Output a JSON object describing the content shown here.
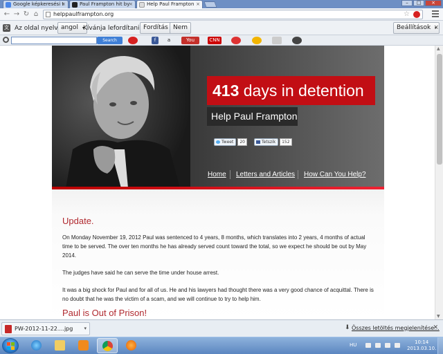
{
  "browser": {
    "tabs": [
      {
        "label": "Google képkeresési t",
        "active": false
      },
      {
        "label": "Paul Frampton hit by",
        "active": false
      },
      {
        "label": "Help Paul Frampton",
        "active": true
      }
    ],
    "url": "helppaulframpton.org"
  },
  "translate_bar": {
    "prefix": "Az oldal nyelve",
    "language": "angol",
    "question": "Kívánja lefordítani?",
    "translate_label": "Fordítás",
    "no_label": "Nem",
    "settings_label": "Beállítások"
  },
  "search_toolbar": {
    "button_label": "Search"
  },
  "site": {
    "days_count": "413",
    "days_text": "days in detention",
    "help_title": "Help Paul Frampton",
    "tweet_label": "Tweet",
    "tweet_count": "20",
    "fb_label": "Tetszik",
    "fb_count": "152",
    "nav": [
      "Home",
      "Letters and Articles",
      "How Can You Help?"
    ],
    "update_heading": "Update.",
    "paragraph1": "On Monday November 19, 2012 Paul was sentenced to 4 years, 8 months, which translates into 2 years, 4 months of actual time to be served. The over ten months he has already served count toward the total, so we expect he should be out by May 2014.",
    "paragraph2": "The judges have said he can serve the time under house arrest.",
    "paragraph3": "It was a big shock for Paul and for all of us. He and his lawyers had thought there was a very good chance of acquittal. There is no doubt that he was the victim of a scam, and we will continue to try to help him.",
    "out_heading": "Paul is Out of Prison!"
  },
  "downloads": {
    "file_name": "PW-2012-11-22....jpg",
    "show_all": "Összes letöltés megjelenítése..."
  },
  "taskbar": {
    "lang": "HU",
    "time": "10:14",
    "date": "2013.03.10."
  }
}
